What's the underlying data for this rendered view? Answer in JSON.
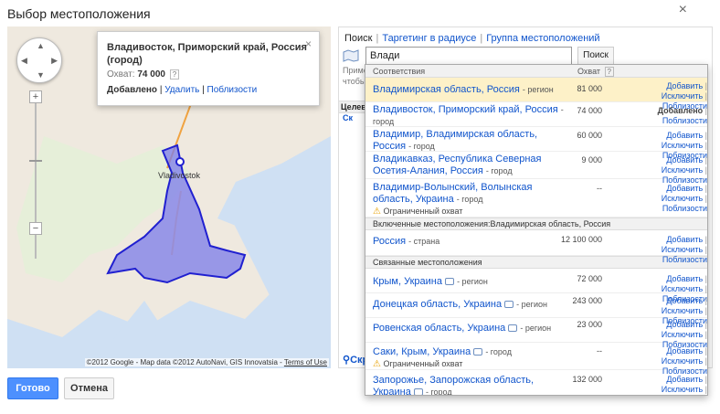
{
  "dialog": {
    "title": "Выбор местоположения",
    "close": "×"
  },
  "map": {
    "city_label": "Vladivostok",
    "credit": "©2012 Google - Map data ©2012 AutoNavi, GIS Innovatsia -",
    "terms": "Terms of Use",
    "zoom_in": "+",
    "zoom_out": "−",
    "bubble": {
      "title": "Владивосток, Приморский край, Россия (город)",
      "reach_label": "Охват:",
      "reach_value": "74 000",
      "help": "?",
      "added": "Добавлено",
      "remove": "Удалить",
      "nearby": "Поблизости",
      "close": "×"
    }
  },
  "buttons": {
    "done": "Готово",
    "cancel": "Отмена"
  },
  "panel": {
    "tabs": [
      "Поиск",
      "Таргетинг в радиусе",
      "Группа местоположений"
    ],
    "bg_text_1": "Приме",
    "bg_text_2": "чтобы",
    "bg_bar": "Целев",
    "bg_link": "Ск",
    "bg_bottom": "Скр"
  },
  "search": {
    "value": "Влади",
    "button": "Поиск"
  },
  "dropdown": {
    "headers": {
      "match": "Соответствия",
      "reach": "Охват",
      "help": "?"
    },
    "actions": {
      "add": "Добавить",
      "exclude": "Исключить",
      "nearby": "Поблизости",
      "added": "Добавлено",
      "sep": "|"
    },
    "warning": "Ограниченный охват",
    "matches": [
      {
        "name": "Владимирская область, Россия",
        "type": "- регион",
        "reach": "81 000"
      },
      {
        "name": "Владивосток, Приморский край, Россия",
        "type": "- город",
        "reach": "74 000"
      },
      {
        "name": "Владимир, Владимирская область, Россия",
        "type": "- город",
        "reach": "60 000"
      },
      {
        "name": "Владикавказ, Республика Северная Осетия-Алания, Россия",
        "type": "- город",
        "reach": "9 000"
      },
      {
        "name": "Владимир-Волынский, Волынская область, Украина",
        "type": "- город",
        "reach": "--"
      }
    ],
    "included_section": "Включенные местоположения:Владимирская область, Россия",
    "included": [
      {
        "name": "Россия",
        "type": "- страна",
        "reach": "12 100 000"
      }
    ],
    "related_section": "Связанные местоположения",
    "related": [
      {
        "name": "Крым, Украина",
        "type": "- регион",
        "reach": "72 000"
      },
      {
        "name": "Донецкая область, Украина",
        "type": "- регион",
        "reach": "243 000"
      },
      {
        "name": "Ровенская область, Украина",
        "type": "- регион",
        "reach": "23 000"
      },
      {
        "name": "Саки, Крым, Украина",
        "type": "- город",
        "reach": "--"
      },
      {
        "name": "Запорожье, Запорожская область, Украина",
        "type": "- город",
        "reach": "132 000"
      }
    ]
  }
}
